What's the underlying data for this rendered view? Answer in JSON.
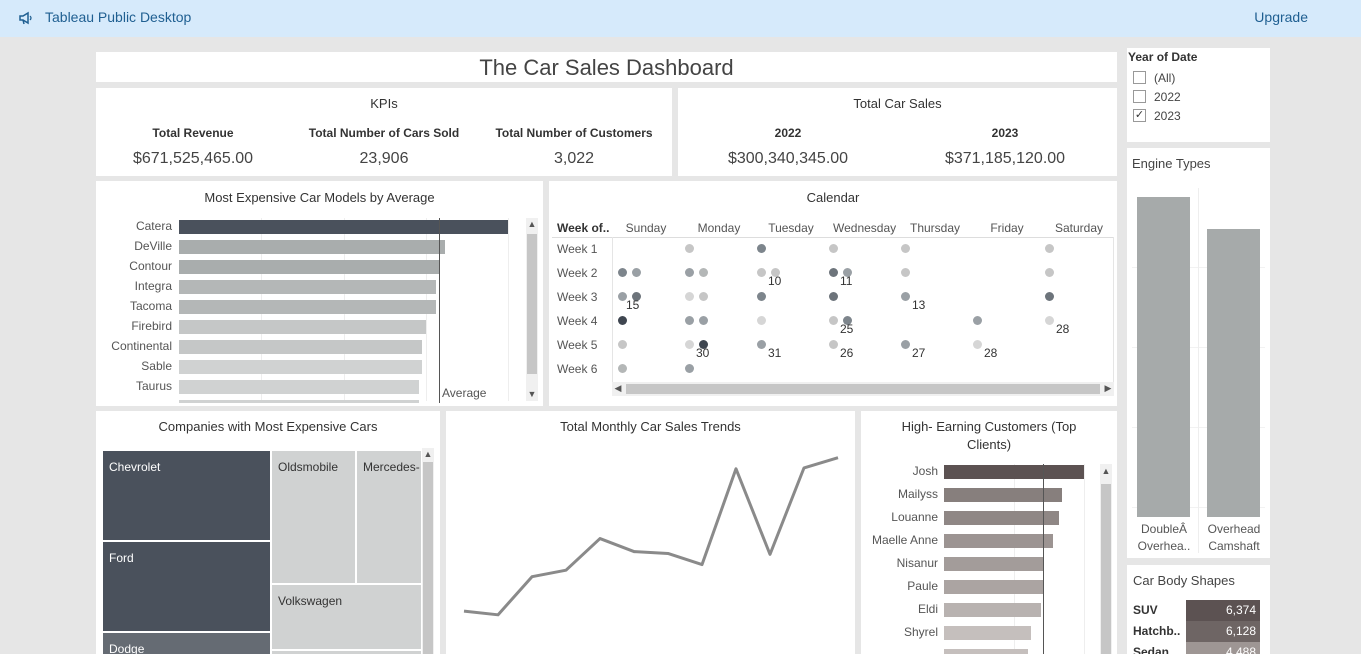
{
  "app": {
    "title": "Tableau Public Desktop",
    "upgrade": "Upgrade"
  },
  "dashboard": {
    "title": "The Car Sales Dashboard"
  },
  "kpis": {
    "title": "KPIs",
    "items": [
      {
        "label": "Total  Revenue",
        "value": "$671,525,465.00"
      },
      {
        "label": "Total Number of Cars Sold",
        "value": "23,906"
      },
      {
        "label": "Total Number of Customers",
        "value": "3,022"
      }
    ]
  },
  "total_sales": {
    "title": "Total Car Sales",
    "items": [
      {
        "label": "2022",
        "value": "$300,340,345.00"
      },
      {
        "label": "2023",
        "value": "$371,185,120.00"
      }
    ]
  },
  "filter": {
    "title": "Year of Date",
    "options": [
      {
        "label": "(All)",
        "checked": false
      },
      {
        "label": "2022",
        "checked": false
      },
      {
        "label": "2023",
        "checked": true
      }
    ]
  },
  "chart_data": [
    {
      "type": "bar",
      "title": "Most Expensive Car Models by Average",
      "categories": [
        "Catera",
        "DeVille",
        "Contour",
        "Integra",
        "Tacoma",
        "Firebird",
        "Continental",
        "Sable",
        "Taurus"
      ],
      "values": [
        100,
        81,
        79,
        78,
        78,
        75,
        74,
        74,
        73
      ],
      "reference_line": {
        "label": "Average",
        "value": 79
      },
      "colors": [
        "#4a515c",
        "#a9adad",
        "#a9adad",
        "#b4b7b7",
        "#b4b7b7",
        "#c5c7c7",
        "#c5c7c7",
        "#d0d2d2",
        "#d0d2d2"
      ]
    },
    {
      "type": "scatter",
      "title": "Calendar",
      "row_header": "Week of..",
      "columns": [
        "Sunday",
        "Monday",
        "Tuesday",
        "Wednesday",
        "Thursday",
        "Friday",
        "Saturday"
      ],
      "rows": [
        "Week 1",
        "Week 2",
        "Week 3",
        "Week 4",
        "Week 5",
        "Week 6"
      ],
      "labels": [
        {
          "week": 2,
          "day": 2,
          "text": "10"
        },
        {
          "week": 2,
          "day": 3,
          "text": "11"
        },
        {
          "week": 3,
          "day": 0,
          "text": "15"
        },
        {
          "week": 3,
          "day": 4,
          "text": "13"
        },
        {
          "week": 4,
          "day": 3,
          "text": "25"
        },
        {
          "week": 4,
          "day": 6,
          "text": "28"
        },
        {
          "week": 5,
          "day": 1,
          "text": "30"
        },
        {
          "week": 5,
          "day": 2,
          "text": "31"
        },
        {
          "week": 5,
          "day": 3,
          "text": "26"
        },
        {
          "week": 5,
          "day": 4,
          "text": "27"
        },
        {
          "week": 5,
          "day": 5,
          "text": "28"
        }
      ]
    },
    {
      "type": "line",
      "title": "Total Monthly Car Sales Trends",
      "x": [
        1,
        2,
        3,
        4,
        5,
        6,
        7,
        8,
        9,
        10,
        11,
        12
      ],
      "y": [
        30,
        26,
        67,
        74,
        108,
        94,
        92,
        80,
        183,
        91,
        184,
        195
      ],
      "color": "#8a8a8a"
    },
    {
      "type": "bar",
      "title": "High- Earning Customers (Top Clients)",
      "categories": [
        "Josh",
        "Mailyss",
        "Louanne",
        "Maelle Anne",
        "Nisanur",
        "Paule",
        "Eldi",
        "Shyrel"
      ],
      "values": [
        100,
        84,
        82,
        78,
        71,
        71,
        69,
        62
      ],
      "colors": [
        "#5c5252",
        "#877f7d",
        "#8f8785",
        "#9c9492",
        "#a39c9a",
        "#aba4a2",
        "#b8b2b0",
        "#c5bfbd"
      ]
    },
    {
      "type": "bar",
      "title": "Engine Types",
      "categories": [
        "DoubleÂ Overhea..",
        "Overhead Camshaft"
      ],
      "values": [
        100,
        90
      ],
      "color": "#a6aaaa"
    },
    {
      "type": "table",
      "title": "Car Body Shapes",
      "rows": [
        {
          "name": "SUV",
          "value": "6,374",
          "color": "#5c5252"
        },
        {
          "name": "Hatchb..",
          "value": "6,128",
          "color": "#6e6564"
        },
        {
          "name": "Sedan",
          "value": "4,488",
          "color": "#9e9694"
        }
      ]
    },
    {
      "type": "table",
      "title": "Companies with Most Expensive Cars",
      "rows": [
        {
          "name": "Chevrolet",
          "color": "#4a515c"
        },
        {
          "name": "Ford",
          "color": "#4a515c"
        },
        {
          "name": "Dodge",
          "color": "#656b73"
        },
        {
          "name": "Oldsmobile",
          "color": "#d0d2d2"
        },
        {
          "name": "Mercedes-",
          "color": "#d0d2d2"
        },
        {
          "name": "Volkswagen",
          "color": "#d0d2d2"
        }
      ]
    }
  ]
}
